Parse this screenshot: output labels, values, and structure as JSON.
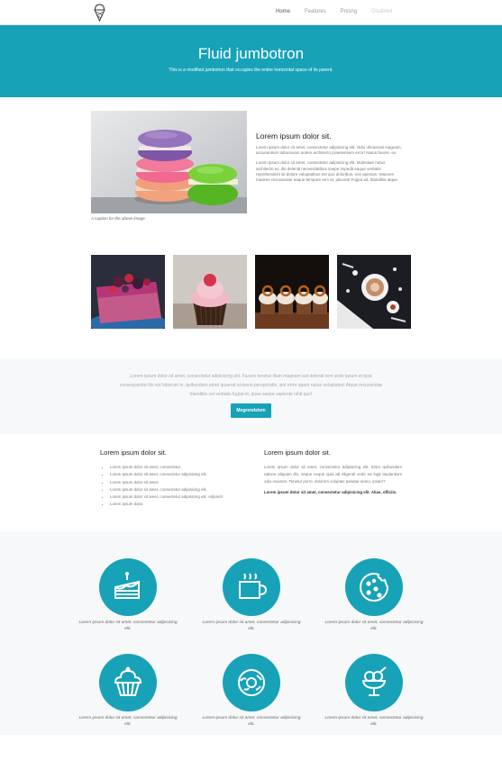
{
  "nav": {
    "links": [
      "Home",
      "Features",
      "Pricing",
      "Disabled"
    ]
  },
  "jumbotron": {
    "title": "Fluid jumbotron",
    "lead": "This is a modified jumbotron that occupies the entire horizontal space of its parent."
  },
  "feature": {
    "caption": "A caption for the above image.",
    "title": "Lorem ipsum dolor sit.",
    "p1": "Lorem ipsum dolor sit amet, consectetur adipisicing elit. Odio obcaecati magnam, accusantium laboriosam autem architecto praesentium error! Natus facere, ex.",
    "p2": "Lorem ipsum dolor sit amet, consectetur adipisicing elit. Molestiae natus architecto ex, illo deleniti necessitatibus saepe impedit eaque veritatis reprehenderit sit dolore voluptatibus est quo doloribus, eos aperiam. Maiores maxime recusandae eaque tempore rem et, placeat! Fugiat ad, blanditiis atque."
  },
  "cta": {
    "text": "Lorem ipsum dolor sit amet, consectetur adipisicing elit. Facere tenetur illum magnam aut deleniti rem unde ipsum et ipsa consequuntur illo est laborum in, quibusdam amet quaerat corporis perspiciatis, sint error quam natus voluptates! Atque recusandae blanditiis vel veritatis fugiat et, quae saepe sapiente nihil quo!",
    "button": "Megrendelem"
  },
  "col_left": {
    "title": "Lorem ipsum dolor sit.",
    "items": [
      "Lorem ipsum dolor sit amet, consectetur.",
      "Lorem ipsum dolor sit amet, consectetur adipisicing elit.",
      "Lorem ipsum dolor sit amet.",
      "Lorem ipsum dolor sit amet, consectetur adipisicing elit.",
      "Lorem ipsum dolor sit amet, consectetur adipisicing elit. Adipisci!",
      "Lorem ipsum dolor."
    ]
  },
  "col_right": {
    "title": "Lorem ipsum dolor sit.",
    "p1": "Lorem ipsum dolor sit amet, consectetur adipisicing elit. Enim quibusdam ratione aliquam illo, neque neque quia ab eligendi unde ea fugit laudantium odio maiores. Tenetur porro, dolorem voluptas pariatur nemo, ipsam?",
    "p2": "Lorem ipsum dolor sit amet, consectetur adipisicing elit. Alias, officiis."
  },
  "icons": [
    {
      "icon": "cake-icon",
      "caption": "Lorem ipsum dolor sit amet, consectetur adipisicing elit."
    },
    {
      "icon": "coffee-cup-icon",
      "caption": "Lorem ipsum dolor sit amet, consectetur adipisicing elit."
    },
    {
      "icon": "cookie-icon",
      "caption": "Lorem ipsum dolor sit amet, consectetur adipisicing elit."
    },
    {
      "icon": "cupcake-icon",
      "caption": "Lorem ipsum dolor sit amet, consectetur adipisicing elit."
    },
    {
      "icon": "donut-icon",
      "caption": "Lorem ipsum dolor sit amet, consectetur adipisicing elit."
    },
    {
      "icon": "ice-cream-icon",
      "caption": "Lorem ipsum dolor sit amet, consectetur adipisicing elit."
    }
  ],
  "colors": {
    "accent": "#17a2b8",
    "section_bg": "#f7f8fa"
  }
}
